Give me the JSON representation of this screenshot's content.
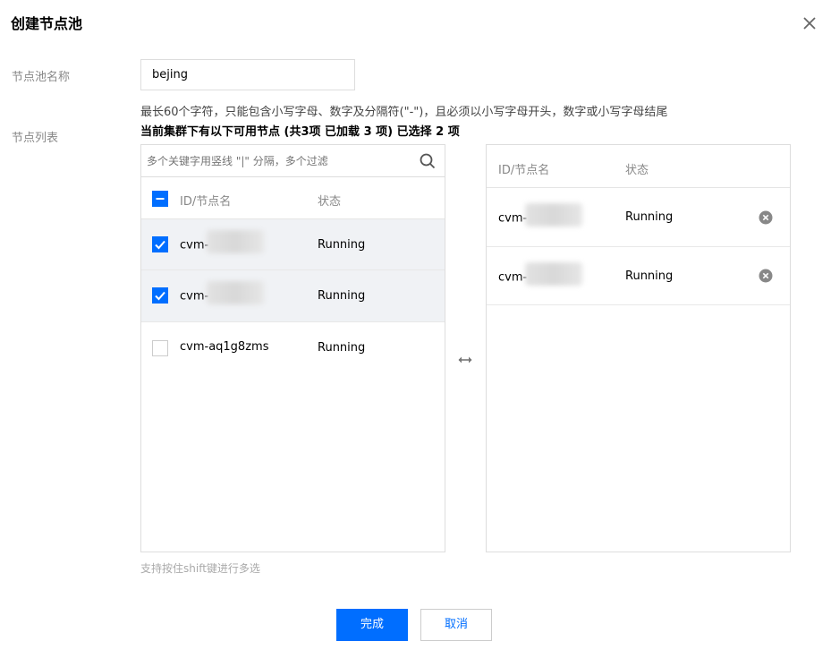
{
  "dialog": {
    "title": "创建节点池"
  },
  "form": {
    "name_label": "节点池名称",
    "name_value": "bejing",
    "name_hint": "最长60个字符，只能包含小写字母、数字及分隔符(\"-\")，且必须以小写字母开头，数字或小写字母结尾",
    "list_label": "节点列表",
    "summary": "当前集群下有以下可用节点 (共3项 已加载 3 项) 已选择 2 项"
  },
  "left_panel": {
    "search_placeholder": "多个关键字用竖线 \"|\" 分隔，多个过滤",
    "header_id": "ID/节点名",
    "header_status": "状态",
    "rows": [
      {
        "id": "cvm-",
        "status": "Running",
        "checked": true
      },
      {
        "id": "cvm-",
        "status": "Running",
        "checked": true
      },
      {
        "id": "cvm-aq1g8zms",
        "status": "Running",
        "checked": false
      }
    ]
  },
  "right_panel": {
    "header_id": "ID/节点名",
    "header_status": "状态",
    "rows": [
      {
        "id": "cvm-",
        "status": "Running"
      },
      {
        "id": "cvm-",
        "status": "Running"
      }
    ]
  },
  "footer": {
    "hint": "支持按住shift键进行多选",
    "confirm_label": "完成",
    "cancel_label": "取消"
  },
  "colors": {
    "primary": "#006eff",
    "selected_row": "#f0f2f5"
  },
  "icons": [
    "close-icon",
    "search-icon",
    "checkbox-check-icon",
    "indeterminate-icon",
    "transfer-arrows-icon",
    "remove-circle-icon"
  ]
}
